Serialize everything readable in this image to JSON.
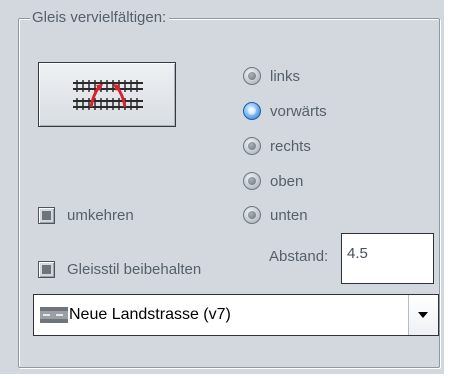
{
  "group": {
    "title": "Gleis vervielfältigen:"
  },
  "duplicate_button": {
    "icon": "track-duplicate-icon"
  },
  "direction": {
    "options": [
      {
        "label": "links",
        "selected": false
      },
      {
        "label": "vorwärts",
        "selected": true
      },
      {
        "label": "rechts",
        "selected": false
      },
      {
        "label": "oben",
        "selected": false
      },
      {
        "label": "unten",
        "selected": false
      }
    ]
  },
  "options": {
    "umkehren_label": "umkehren",
    "umkehren_state": "indeterminate",
    "gleisstil_label": "Gleisstil beibehalten",
    "gleisstil_state": "indeterminate"
  },
  "abstand": {
    "label": "Abstand:",
    "value": "4.5"
  },
  "track_style": {
    "selected": "Neue Landstrasse (v7)",
    "icon": "road-style-icon"
  },
  "colors": {
    "panel_bg": "#d3d8de",
    "selected_radio": "#2a78d0",
    "track_red": "#d8242a"
  }
}
